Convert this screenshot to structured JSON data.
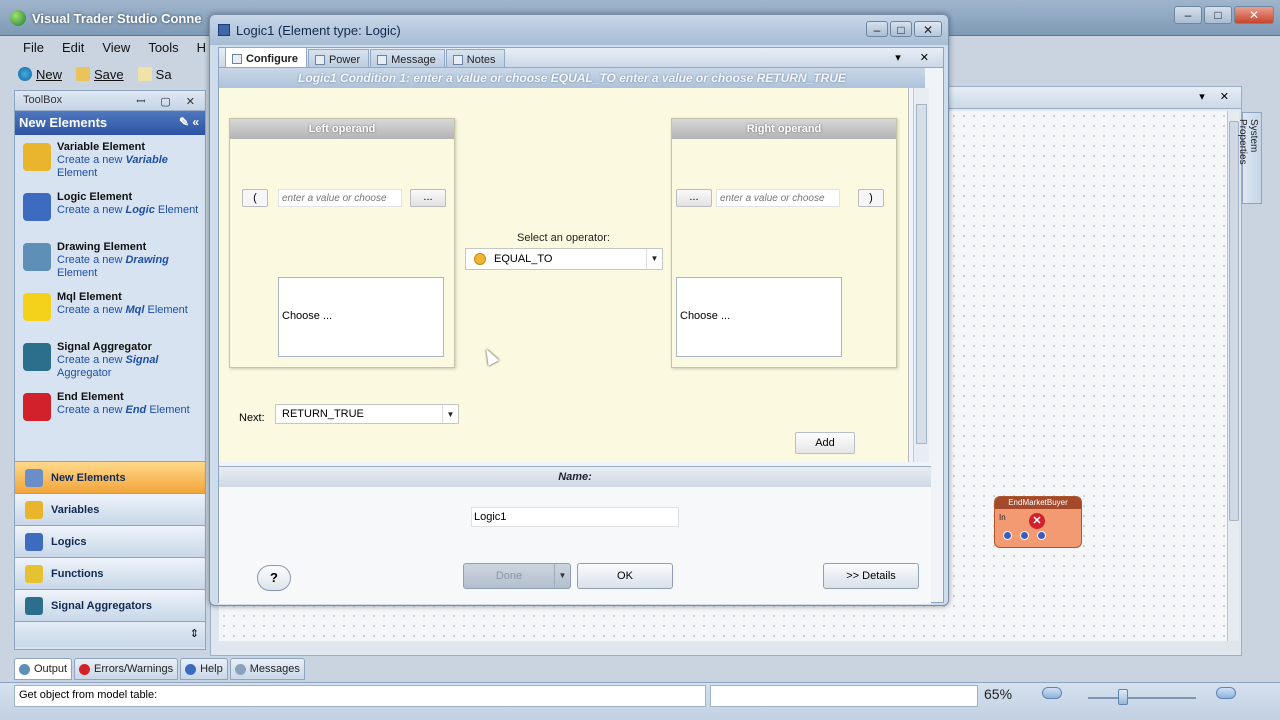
{
  "app": {
    "title": "Visual Trader Studio Conne",
    "caption": {
      "minimize": "–",
      "maximize": "□",
      "close": "✕"
    }
  },
  "menu": [
    "File",
    "Edit",
    "View",
    "Tools",
    "H"
  ],
  "toolbar": {
    "new_label": "New",
    "save_label": "Save",
    "extra_label": "Sa"
  },
  "toolbox": {
    "header": "ToolBox",
    "header_buttons": "ꟷ ▢ ✕",
    "section_title": "New Elements",
    "section_icons": "✎ «",
    "elements": [
      {
        "title": "Variable Element",
        "desc_prefix": "Create a new ",
        "desc_kw": "Variable",
        "desc_suffix": " Element",
        "icon": "cylinder-icon",
        "color": "#e9b52c"
      },
      {
        "title": "Logic Element",
        "desc_prefix": "Create a new ",
        "desc_kw": "Logic",
        "desc_suffix": " Element",
        "icon": "hierarchy-icon",
        "color": "#3c6bbf"
      },
      {
        "title": "Drawing Element",
        "desc_prefix": "Create a new ",
        "desc_kw": "Drawing",
        "desc_suffix": " Element",
        "icon": "drawing-icon",
        "color": "#5d8fb7"
      },
      {
        "title": "Mql Element",
        "desc_prefix": "Create a new ",
        "desc_kw": "Mql",
        "desc_suffix": " Element",
        "icon": "warning-icon",
        "color": "#f4d21c"
      },
      {
        "title": "Signal Aggregator",
        "desc_prefix": "Create a new ",
        "desc_kw": "Signal",
        "desc_suffix": " Aggregator",
        "icon": "signal-icon",
        "color": "#2b6f8c"
      },
      {
        "title": "End Element",
        "desc_prefix": "Create a new ",
        "desc_kw": "End",
        "desc_suffix": " Element",
        "icon": "stop-icon",
        "color": "#d2212a"
      }
    ],
    "nav": [
      {
        "label": "New Elements",
        "icon": "new-elements-icon",
        "color": "#6a8fc8"
      },
      {
        "label": "Variables",
        "icon": "variables-icon",
        "color": "#e9b52c"
      },
      {
        "label": "Logics",
        "icon": "logics-icon",
        "color": "#3c6bbf"
      },
      {
        "label": "Functions",
        "icon": "functions-icon",
        "color": "#e6c233"
      },
      {
        "label": "Signal Aggregators",
        "icon": "signal-aggregators-icon",
        "color": "#2b6f8c"
      }
    ],
    "nav_footer": "⇕"
  },
  "dialog": {
    "title": "Logic1 (Element type: Logic)",
    "tabs": [
      "Configure",
      "Power",
      "Message",
      "Notes"
    ],
    "strip_buttons": "▾ ✕",
    "condition_text": "Logic1  Condition 1:  enter a value or choose EQUAL_TO enter a value or choose  RETURN_TRUE",
    "left_operand": {
      "header": "Left operand",
      "paren": "(",
      "placeholder": "enter a value or choose",
      "dots": "...",
      "choose": "Choose ..."
    },
    "right_operand": {
      "header": "Right operand",
      "paren": ")",
      "placeholder": "enter a value or choose",
      "dots": "...",
      "choose": "Choose ..."
    },
    "operator_label": "Select an operator:",
    "operator_value": "EQUAL_TO",
    "next_label": "Next:",
    "next_value": "RETURN_TRUE",
    "add_label": "Add",
    "name_header": "Name:",
    "name_value": "Logic1",
    "help_label": "?",
    "done_label": "Done",
    "ok_label": "OK",
    "details_label": ">> Details"
  },
  "canvas": {
    "node_title": "EndMarketBuyer",
    "node_in": "In",
    "system_properties": "System Properties"
  },
  "bottom_tabs": [
    {
      "label": "Output",
      "color": "#5d8fb7"
    },
    {
      "label": "Errors/Warnings",
      "color": "#d2212a"
    },
    {
      "label": "Help",
      "color": "#3c6bbf"
    },
    {
      "label": "Messages",
      "color": "#8aa1bd"
    }
  ],
  "status": {
    "text": "Get object from model table:",
    "zoom": "65%"
  },
  "colors": {
    "accent": "#2d54a3",
    "active_nav": "#f2a43a",
    "config_bg": "#fbf9e0"
  }
}
